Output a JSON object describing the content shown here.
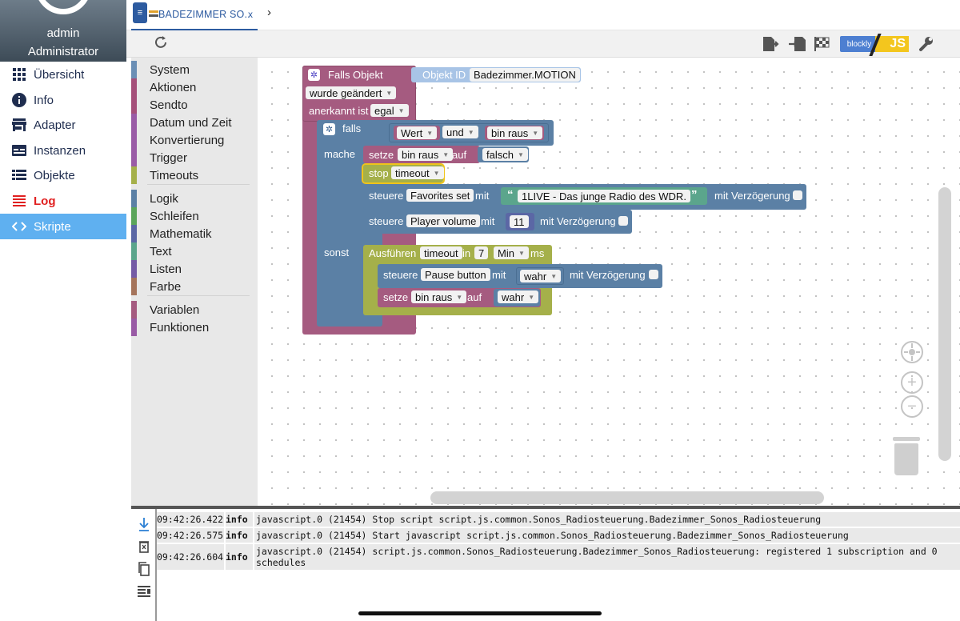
{
  "user": {
    "name": "admin",
    "role": "Administrator"
  },
  "nav": {
    "items": [
      {
        "label": "Übersicht",
        "icon": "grid-icon"
      },
      {
        "label": "Info",
        "icon": "info-icon"
      },
      {
        "label": "Adapter",
        "icon": "store-icon"
      },
      {
        "label": "Instanzen",
        "icon": "instances-icon"
      },
      {
        "label": "Objekte",
        "icon": "list-icon"
      },
      {
        "label": "Log",
        "icon": "log-icon"
      },
      {
        "label": "Skripte",
        "icon": "code-icon"
      }
    ]
  },
  "tab": {
    "label": "BADEZIMMER SO..",
    "close": "x"
  },
  "toolbar": {
    "icons": [
      "export-icon",
      "import-icon",
      "flag-icon",
      "settings-wrench-icon"
    ],
    "blockly_label": "blockly",
    "js_label": "JS"
  },
  "categories": [
    {
      "label": "System",
      "color": "#6b8fb5"
    },
    {
      "label": "Aktionen",
      "color": "#a5507a"
    },
    {
      "label": "Sendto",
      "color": "#a5507a"
    },
    {
      "label": "Datum und Zeit",
      "color": "#9a5ca6"
    },
    {
      "label": "Konvertierung",
      "color": "#9a5ca6"
    },
    {
      "label": "Trigger",
      "color": "#9a5ca6"
    },
    {
      "label": "Timeouts",
      "color": "#a5b04a"
    },
    {
      "label": "Logik",
      "color": "#5b80a5"
    },
    {
      "label": "Schleifen",
      "color": "#5ba55b"
    },
    {
      "label": "Mathematik",
      "color": "#5b67a5"
    },
    {
      "label": "Text",
      "color": "#5ba58c"
    },
    {
      "label": "Listen",
      "color": "#745ba5"
    },
    {
      "label": "Farbe",
      "color": "#a5745b"
    },
    {
      "label": "Variablen",
      "color": "#a55b80"
    },
    {
      "label": "Funktionen",
      "color": "#995ba5"
    }
  ],
  "blocks": {
    "trigger_title": "Falls Objekt",
    "object_id_label": "Objekt ID",
    "object_id_value": "Badezimmer.MOTION",
    "changed_option": "wurde geändert",
    "ack_label": "anerkannt ist",
    "ack_value": "egal",
    "if_label": "falls",
    "do_label": "mache",
    "else_label": "sonst",
    "cond_var1": "Wert",
    "cond_op": "und",
    "cond_var2": "bin raus",
    "set_label": "setze",
    "set_var": "bin raus",
    "set_to": "auf",
    "set_value1": "falsch",
    "stop_label": "stop",
    "stop_var": "timeout",
    "control_label": "steuere",
    "control1_target": "Favorites set",
    "with_label": "mit",
    "control1_text": "1LIVE - Das junge Radio des WDR.",
    "delay_label": "mit Verzögerung",
    "control2_target": "Player volume",
    "control2_value": "11",
    "run_label": "Ausführen",
    "run_var": "timeout",
    "in_label": "in",
    "run_amount": "7",
    "run_unit": "Min",
    "ms_label": "ms",
    "control3_target": "Pause button",
    "control3_value": "wahr",
    "set2_var": "bin raus",
    "set2_value": "wahr"
  },
  "log": {
    "rows": [
      {
        "time": "09:42:26.422",
        "level": "info",
        "message": "javascript.0 (21454) Stop script script.js.common.Sonos_Radiosteuerung.Badezimmer_Sonos_Radiosteuerung"
      },
      {
        "time": "09:42:26.575",
        "level": "info",
        "message": "javascript.0 (21454) Start javascript script.js.common.Sonos_Radiosteuerung.Badezimmer_Sonos_Radiosteuerung"
      },
      {
        "time": "09:42:26.604",
        "level": "info",
        "message": "javascript.0 (21454) script.js.common.Sonos_Radiosteuerung.Badezimmer_Sonos_Radiosteuerung: registered 1 subscription and 0",
        "message2": "schedules"
      }
    ]
  }
}
